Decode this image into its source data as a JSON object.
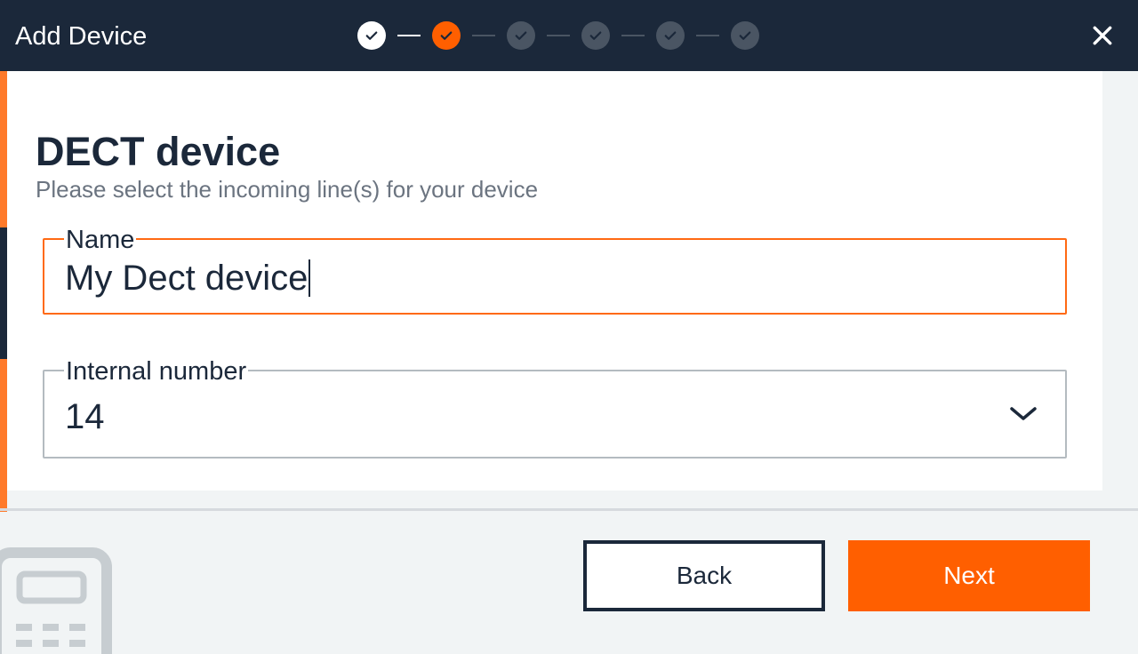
{
  "header": {
    "title": "Add Device",
    "steps": [
      {
        "state": "done"
      },
      {
        "state": "current"
      },
      {
        "state": "pending"
      },
      {
        "state": "pending"
      },
      {
        "state": "pending"
      },
      {
        "state": "pending"
      }
    ],
    "close_icon": "close-icon"
  },
  "page": {
    "title": "DECT device",
    "subtitle": "Please select the incoming line(s) for your device"
  },
  "form": {
    "name": {
      "label": "Name",
      "value": "My Dect device"
    },
    "internal_number": {
      "label": "Internal number",
      "value": "14",
      "icon": "chevron-down-icon"
    }
  },
  "footer": {
    "back_label": "Back",
    "next_label": "Next"
  },
  "colors": {
    "header_bg": "#1b283a",
    "accent": "#ff5f00",
    "pending_step": "#4a5563",
    "text_dark": "#1b283a",
    "text_muted": "#6b7480"
  }
}
